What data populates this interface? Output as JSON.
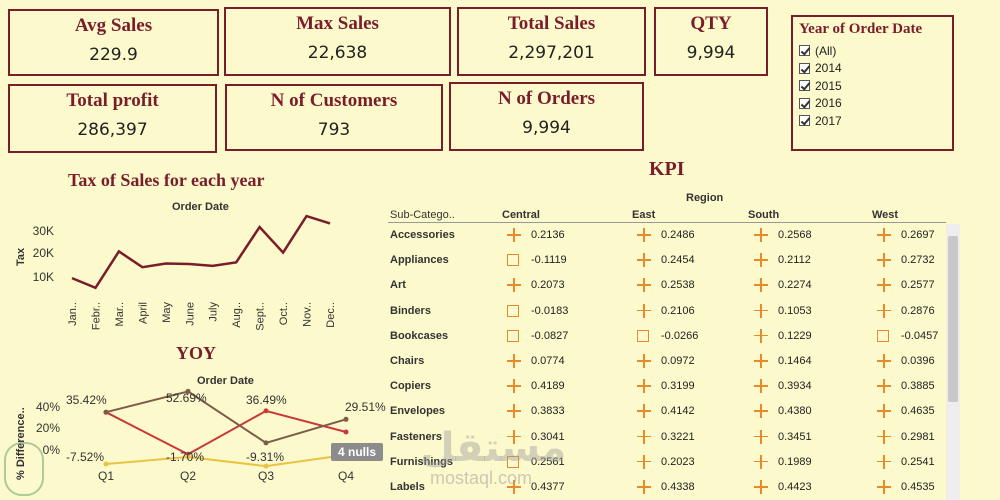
{
  "cards": {
    "avg_sales": {
      "title": "Avg Sales",
      "value": "229.9"
    },
    "max_sales": {
      "title": "Max Sales",
      "value": "22,638"
    },
    "total_sales": {
      "title": "Total Sales",
      "value": "2,297,201"
    },
    "qty": {
      "title": "QTY",
      "value": "9,994"
    },
    "total_profit": {
      "title": "Total profit",
      "value": "286,397"
    },
    "n_customers": {
      "title": "N of Customers",
      "value": "793"
    },
    "n_orders": {
      "title": "N of Orders",
      "value": "9,994"
    }
  },
  "filter": {
    "title": "Year of Order Date",
    "items": [
      "(All)",
      "2014",
      "2015",
      "2016",
      "2017"
    ]
  },
  "tax_chart": {
    "title": "Tax of Sales for each year",
    "header": "Order Date",
    "ylabel": "Tax",
    "yticks": [
      "30K",
      "20K",
      "10K"
    ]
  },
  "yoy_chart": {
    "title": "YOY",
    "header": "Order Date",
    "ylabel": "% Difference..",
    "yticks": [
      "40%",
      "20%",
      "0%"
    ],
    "nulls_badge": "4 nulls",
    "data_labels": [
      "35.42%",
      "52.69%",
      "36.49%",
      "29.51%",
      "-7.52%",
      "-1.70%",
      "-9.31%"
    ]
  },
  "kpi": {
    "title": "KPI",
    "region_label": "Region",
    "subcat_label": "Sub-Catego..",
    "regions": [
      "Central",
      "East",
      "South",
      "West"
    ],
    "rows": [
      {
        "name": "Accessories",
        "values": [
          "0.2136",
          "0.2486",
          "0.2568",
          "0.2697"
        ],
        "marks": [
          "plus",
          "plus",
          "plus",
          "plus"
        ]
      },
      {
        "name": "Appliances",
        "values": [
          "-0.1119",
          "0.2454",
          "0.2112",
          "0.2732"
        ],
        "marks": [
          "sq",
          "plus",
          "plus",
          "plus"
        ]
      },
      {
        "name": "Art",
        "values": [
          "0.2073",
          "0.2538",
          "0.2274",
          "0.2577"
        ],
        "marks": [
          "plus",
          "plus",
          "plus",
          "plus"
        ]
      },
      {
        "name": "Binders",
        "values": [
          "-0.0183",
          "0.2106",
          "0.1053",
          "0.2876"
        ],
        "marks": [
          "sq",
          "plus",
          "plus",
          "plus"
        ]
      },
      {
        "name": "Bookcases",
        "values": [
          "-0.0827",
          "-0.0266",
          "0.1229",
          "-0.0457"
        ],
        "marks": [
          "sq",
          "sq",
          "plus",
          "sq"
        ]
      },
      {
        "name": "Chairs",
        "values": [
          "0.0774",
          "0.0972",
          "0.1464",
          "0.0396"
        ],
        "marks": [
          "plus",
          "plus",
          "plus",
          "plus"
        ]
      },
      {
        "name": "Copiers",
        "values": [
          "0.4189",
          "0.3199",
          "0.3934",
          "0.3885"
        ],
        "marks": [
          "plus",
          "plus",
          "plus",
          "plus"
        ]
      },
      {
        "name": "Envelopes",
        "values": [
          "0.3833",
          "0.4142",
          "0.4380",
          "0.4635"
        ],
        "marks": [
          "plus",
          "plus",
          "plus",
          "plus"
        ]
      },
      {
        "name": "Fasteners",
        "values": [
          "0.3041",
          "0.3221",
          "0.3451",
          "0.2981"
        ],
        "marks": [
          "plus",
          "plus",
          "plus",
          "plus"
        ]
      },
      {
        "name": "Furnishings",
        "values": [
          "0.2561",
          "0.2023",
          "0.1989",
          "0.2541"
        ],
        "marks": [
          "sq",
          "plus",
          "plus",
          "plus"
        ]
      },
      {
        "name": "Labels",
        "values": [
          "0.4377",
          "0.4338",
          "0.4423",
          "0.4535"
        ],
        "marks": [
          "plus",
          "plus",
          "plus",
          "plus"
        ]
      }
    ]
  },
  "watermark": {
    "arabic": "مستقل",
    "latin": "mostaql.com"
  },
  "colors": {
    "brand": "#7a1d2b",
    "background": "#fcf9cc",
    "kpi_mark": "#e8892a",
    "yoy_red": "#c9383a",
    "yoy_brown": "#7d5b48",
    "yoy_yellow": "#e9c341"
  },
  "chart_data": [
    {
      "type": "line",
      "title": "Tax of Sales for each year",
      "xlabel": "Order Date",
      "ylabel": "Tax",
      "categories": [
        "Jan..",
        "Febr..",
        "Mar..",
        "April",
        "May",
        "June",
        "July",
        "Aug..",
        "Sept..",
        "Oct..",
        "Nov..",
        "Dec.."
      ],
      "values": [
        9000,
        5000,
        20000,
        13500,
        15000,
        14800,
        14000,
        15500,
        30000,
        19500,
        34500,
        31500
      ],
      "ylim": [
        0,
        37000
      ]
    },
    {
      "type": "line",
      "title": "YOY",
      "xlabel": "Order Date",
      "ylabel": "% Difference..",
      "categories": [
        "Q1",
        "Q2",
        "Q3",
        "Q4"
      ],
      "ylim": [
        -15,
        58
      ],
      "series": [
        {
          "values": [
            35.42,
            0.5,
            36.49,
            19
          ]
        },
        {
          "values": [
            35.42,
            52.69,
            10,
            29.51
          ]
        },
        {
          "values": [
            -7.52,
            -1.7,
            -9.31,
            0
          ]
        }
      ]
    }
  ]
}
